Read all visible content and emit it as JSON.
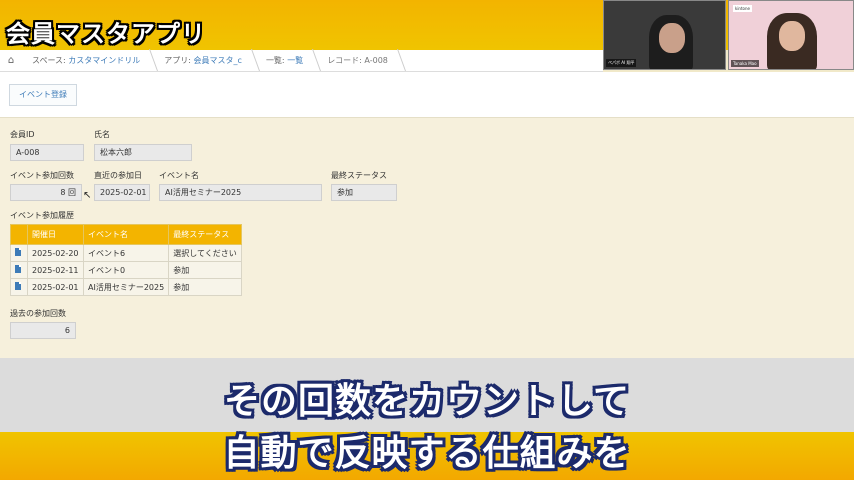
{
  "video": {
    "title": "会員マスタアプリ",
    "caption_line1": "その回数をカウントして",
    "caption_line2": "自動で反映する仕組みを",
    "participants": [
      {
        "name": "ペパボ AI 翔平"
      },
      {
        "name": "Tanaka Mao",
        "logo": "kintone"
      }
    ]
  },
  "breadcrumb": {
    "items": [
      {
        "prefix": "スペース: ",
        "link": "カスタマインドリル"
      },
      {
        "prefix": "アプリ: ",
        "link": "会員マスタ_c"
      },
      {
        "prefix": "一覧: ",
        "link": "一覧"
      },
      {
        "prefix": "",
        "link": "レコード: A-008"
      }
    ]
  },
  "toolbar": {
    "event_button": "イベント登録"
  },
  "record": {
    "member_id": {
      "label": "会員ID",
      "value": "A-008"
    },
    "name": {
      "label": "氏名",
      "value": "松本六郎"
    },
    "event_count": {
      "label": "イベント参加回数",
      "value": "8 回"
    },
    "last_date": {
      "label": "直近の参加日",
      "value": "2025-02-01"
    },
    "event_name": {
      "label": "イベント名",
      "value": "AI活用セミナー2025"
    },
    "final_status": {
      "label": "最終ステータス",
      "value": "参加"
    },
    "history": {
      "label": "イベント参加履歴",
      "headers": [
        "開催日",
        "イベント名",
        "最終ステータス"
      ],
      "rows": [
        {
          "date": "2025-02-20",
          "event": "イベント6",
          "status": "選択してください"
        },
        {
          "date": "2025-02-11",
          "event": "イベント0",
          "status": "参加"
        },
        {
          "date": "2025-02-01",
          "event": "AI活用セミナー2025",
          "status": "参加"
        }
      ]
    },
    "past_count": {
      "label": "過去の参加回数",
      "value": "6"
    }
  },
  "colors": {
    "accent": "#f3b400",
    "link": "#3d7bb8",
    "caption_outline": "#1c2a6b"
  }
}
